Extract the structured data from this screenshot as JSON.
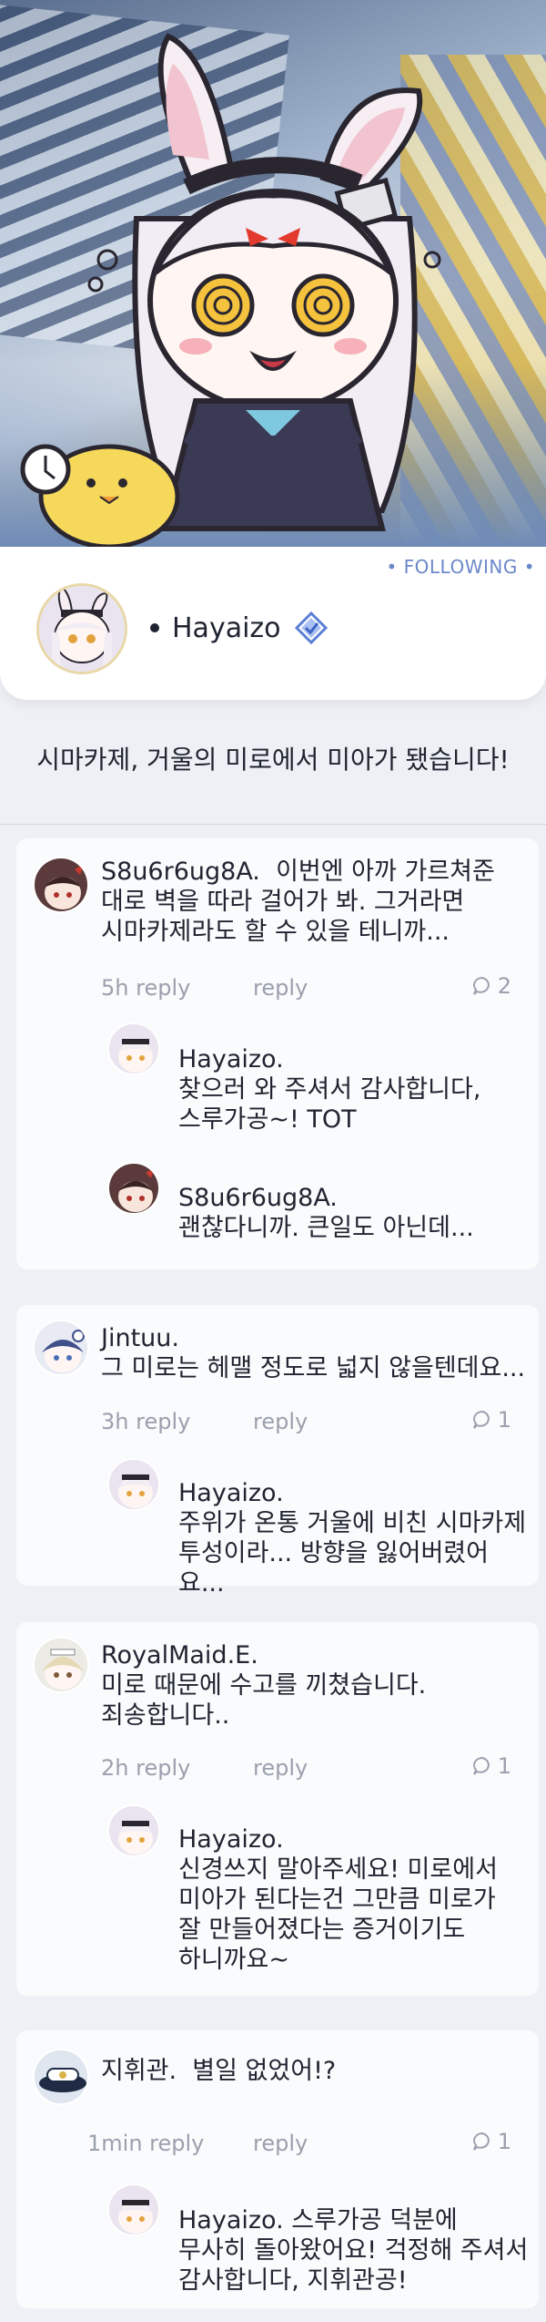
{
  "hero": {
    "alt": ""
  },
  "profile": {
    "following_label": "• FOLLOWING •",
    "name": "Hayaizo",
    "verified_icon": "verified-badge-icon"
  },
  "post": {
    "title": "시마카제, 거울의 미로에서 미아가 됐습니다!"
  },
  "comments": [
    {
      "author": "S8u6r6ug8A.",
      "text_line1": "이번엔 아까 가르쳐준",
      "text_line2": "대로 벽을 따라 걸어가 봐. 그거라면",
      "text_line3": "시마카제라도 할 수 있을 테니까...",
      "time": "5h",
      "reply_label": "reply",
      "reply_label2": "reply",
      "reply_count": "2",
      "replies": [
        {
          "author": "Hayaizo.",
          "line1": "찾으러 와 주셔서 감사합니다,",
          "line2": "스루가공~! TOT"
        },
        {
          "author": "S8u6r6ug8A.",
          "line1": "괜찮다니까. 큰일도 아닌데..."
        }
      ]
    },
    {
      "author": "Jintuu.",
      "text_line1": "그 미로는 헤맬 정도로 넓지 않을텐데요...",
      "time": "3h",
      "reply_label": "reply",
      "reply_label2": "reply",
      "reply_count": "1",
      "replies": [
        {
          "author": "Hayaizo.",
          "line1": "주위가 온통 거울에 비친 시마카제",
          "line2": "투성이라... 방향을 잃어버렸어요..."
        }
      ]
    },
    {
      "author": "RoyalMaid.E.",
      "text_line1": "미로 때문에 수고를 끼쳤습니다.",
      "text_line2": "죄송합니다..",
      "time": "2h",
      "reply_label": "reply",
      "reply_label2": "reply",
      "reply_count": "1",
      "replies": [
        {
          "author": "Hayaizo.",
          "line1": "신경쓰지 말아주세요! 미로에서",
          "line2": "미아가 된다는건 그만큼 미로가",
          "line3": "잘 만들어졌다는 증거이기도",
          "line4": "하니까요~"
        }
      ]
    },
    {
      "author": "지휘관.",
      "text_line1": "별일 없었어!?",
      "time": "1min",
      "reply_label": "reply",
      "reply_label2": "reply",
      "reply_count": "1",
      "replies": [
        {
          "author": "Hayaizo.",
          "line1": "스루가공 덕분에",
          "line2": "무사히 돌아왔어요! 걱정해 주셔서",
          "line3": "감사합니다, 지휘관공!"
        }
      ]
    }
  ],
  "colors": {
    "accent": "#6b88c9",
    "meta": "#9aa0ad",
    "text": "#1f2430",
    "bg": "#eef0f5",
    "card": "#fafbfd"
  }
}
